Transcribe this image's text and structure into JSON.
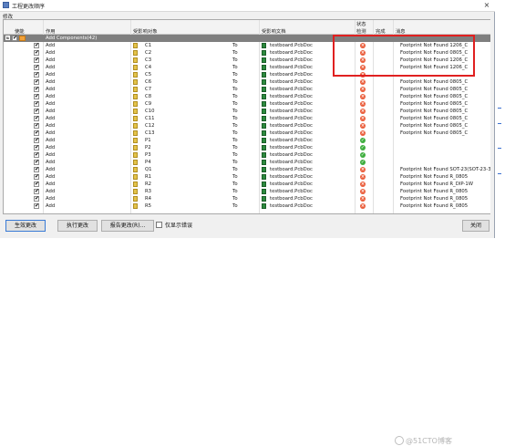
{
  "window": {
    "title": "工程更改顺序",
    "close_label": "×"
  },
  "group_label": "修改",
  "columns": {
    "top": {
      "status": "状态"
    },
    "enable": "使能",
    "action": "作用",
    "affected_object": "受影响对象",
    "affected_doc": "受影响文档",
    "check": "检测",
    "done": "完成",
    "message": "消息"
  },
  "group_row": {
    "expand": "+",
    "label": "Add Components(42)"
  },
  "rows": [
    {
      "action": "Add",
      "object": "C1",
      "to": "To",
      "doc": "testboard.PcbDoc",
      "status": "err",
      "message": "Footprint Not Found 1206_C"
    },
    {
      "action": "Add",
      "object": "C2",
      "to": "To",
      "doc": "testboard.PcbDoc",
      "status": "err",
      "message": "Footprint Not Found 0805_C"
    },
    {
      "action": "Add",
      "object": "C3",
      "to": "To",
      "doc": "testboard.PcbDoc",
      "status": "err",
      "message": "Footprint Not Found 1206_C"
    },
    {
      "action": "Add",
      "object": "C4",
      "to": "To",
      "doc": "testboard.PcbDoc",
      "status": "err",
      "message": "Footprint Not Found 1206_C"
    },
    {
      "action": "Add",
      "object": "C5",
      "to": "To",
      "doc": "testboard.PcbDoc",
      "status": "err",
      "message": ""
    },
    {
      "action": "Add",
      "object": "C6",
      "to": "To",
      "doc": "testboard.PcbDoc",
      "status": "err",
      "message": "Footprint Not Found 0805_C"
    },
    {
      "action": "Add",
      "object": "C7",
      "to": "To",
      "doc": "testboard.PcbDoc",
      "status": "err",
      "message": "Footprint Not Found 0805_C"
    },
    {
      "action": "Add",
      "object": "C8",
      "to": "To",
      "doc": "testboard.PcbDoc",
      "status": "err",
      "message": "Footprint Not Found 0805_C"
    },
    {
      "action": "Add",
      "object": "C9",
      "to": "To",
      "doc": "testboard.PcbDoc",
      "status": "err",
      "message": "Footprint Not Found 0805_C"
    },
    {
      "action": "Add",
      "object": "C10",
      "to": "To",
      "doc": "testboard.PcbDoc",
      "status": "err",
      "message": "Footprint Not Found 0805_C"
    },
    {
      "action": "Add",
      "object": "C11",
      "to": "To",
      "doc": "testboard.PcbDoc",
      "status": "err",
      "message": "Footprint Not Found 0805_C"
    },
    {
      "action": "Add",
      "object": "C12",
      "to": "To",
      "doc": "testboard.PcbDoc",
      "status": "err",
      "message": "Footprint Not Found 0805_C"
    },
    {
      "action": "Add",
      "object": "C13",
      "to": "To",
      "doc": "testboard.PcbDoc",
      "status": "err",
      "message": "Footprint Not Found 0805_C"
    },
    {
      "action": "Add",
      "object": "P1",
      "to": "To",
      "doc": "testboard.PcbDoc",
      "status": "ok",
      "message": ""
    },
    {
      "action": "Add",
      "object": "P2",
      "to": "To",
      "doc": "testboard.PcbDoc",
      "status": "ok",
      "message": ""
    },
    {
      "action": "Add",
      "object": "P3",
      "to": "To",
      "doc": "testboard.PcbDoc",
      "status": "ok",
      "message": ""
    },
    {
      "action": "Add",
      "object": "P4",
      "to": "To",
      "doc": "testboard.PcbDoc",
      "status": "ok",
      "message": ""
    },
    {
      "action": "Add",
      "object": "Q1",
      "to": "To",
      "doc": "testboard.PcbDoc",
      "status": "err",
      "message": "Footprint Not Found SOT-23(SOT-23-3)"
    },
    {
      "action": "Add",
      "object": "R1",
      "to": "To",
      "doc": "testboard.PcbDoc",
      "status": "err",
      "message": "Footprint Not Found R_0805"
    },
    {
      "action": "Add",
      "object": "R2",
      "to": "To",
      "doc": "testboard.PcbDoc",
      "status": "err",
      "message": "Footprint Not Found R_DIP-1W"
    },
    {
      "action": "Add",
      "object": "R3",
      "to": "To",
      "doc": "testboard.PcbDoc",
      "status": "err",
      "message": "Footprint Not Found R_0805"
    },
    {
      "action": "Add",
      "object": "R4",
      "to": "To",
      "doc": "testboard.PcbDoc",
      "status": "err",
      "message": "Footprint Not Found R_0805"
    },
    {
      "action": "Add",
      "object": "R5",
      "to": "To",
      "doc": "testboard.PcbDoc",
      "status": "err",
      "message": "Footprint Not Found R_0805"
    }
  ],
  "buttons": {
    "validate": "生效更改",
    "execute": "执行更改",
    "report": "报告更改(R)...",
    "only_errors": "仅显示错误",
    "close": "关闭"
  },
  "watermark": "@51CTO博客",
  "colors": {
    "error": "#ea5c3a",
    "ok": "#3fae3f",
    "highlight": "#e02020"
  }
}
